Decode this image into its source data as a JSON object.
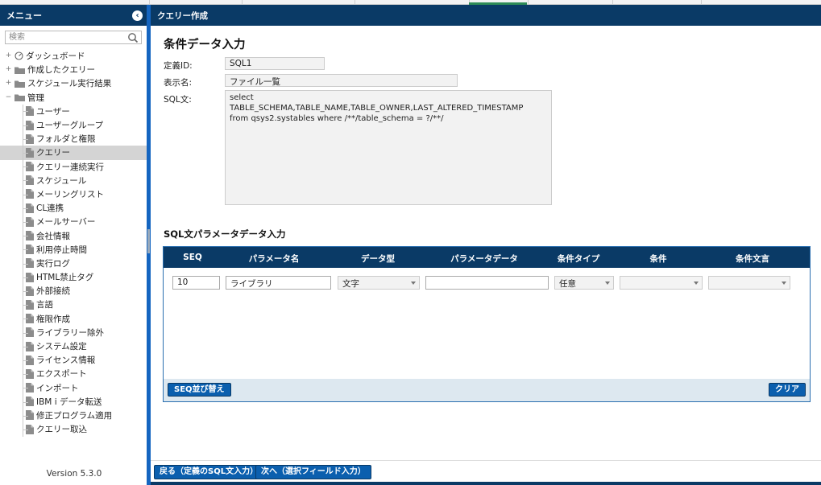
{
  "sidebar": {
    "title": "メニュー",
    "collapse_icon": "chevron-left-icon",
    "search_placeholder": "検索",
    "tree": [
      {
        "label": "ダッシュボード",
        "icon": "dashboard-icon",
        "level": 0,
        "expander": "+"
      },
      {
        "label": "作成したクエリー",
        "icon": "folder-icon",
        "level": 0,
        "expander": "+"
      },
      {
        "label": "スケジュール実行結果",
        "icon": "folder-icon",
        "level": 0,
        "expander": "+"
      },
      {
        "label": "管理",
        "icon": "folder-icon",
        "level": 0,
        "expander": "−"
      },
      {
        "label": "ユーザー",
        "icon": "document-icon",
        "level": 1
      },
      {
        "label": "ユーザーグループ",
        "icon": "document-icon",
        "level": 1
      },
      {
        "label": "フォルダと権限",
        "icon": "document-icon",
        "level": 1
      },
      {
        "label": "クエリー",
        "icon": "document-icon",
        "level": 1,
        "selected": true
      },
      {
        "label": "クエリー連続実行",
        "icon": "document-icon",
        "level": 1
      },
      {
        "label": "スケジュール",
        "icon": "document-icon",
        "level": 1
      },
      {
        "label": "メーリングリスト",
        "icon": "document-icon",
        "level": 1
      },
      {
        "label": "CL連携",
        "icon": "document-icon",
        "level": 1
      },
      {
        "label": "メールサーバー",
        "icon": "document-icon",
        "level": 1
      },
      {
        "label": "会社情報",
        "icon": "document-icon",
        "level": 1
      },
      {
        "label": "利用停止時間",
        "icon": "document-icon",
        "level": 1
      },
      {
        "label": "実行ログ",
        "icon": "document-icon",
        "level": 1
      },
      {
        "label": "HTML禁止タグ",
        "icon": "document-icon",
        "level": 1
      },
      {
        "label": "外部接続",
        "icon": "document-icon",
        "level": 1
      },
      {
        "label": "言語",
        "icon": "document-icon",
        "level": 1
      },
      {
        "label": "権限作成",
        "icon": "document-icon",
        "level": 1
      },
      {
        "label": "ライブラリー除外",
        "icon": "document-icon",
        "level": 1
      },
      {
        "label": "システム設定",
        "icon": "document-icon",
        "level": 1
      },
      {
        "label": "ライセンス情報",
        "icon": "document-icon",
        "level": 1
      },
      {
        "label": "エクスポート",
        "icon": "document-icon",
        "level": 1
      },
      {
        "label": "インポート",
        "icon": "document-icon",
        "level": 1
      },
      {
        "label": "IBM i データ転送",
        "icon": "document-icon",
        "level": 1
      },
      {
        "label": "修正プログラム適用",
        "icon": "document-icon",
        "level": 1
      },
      {
        "label": "クエリー取込",
        "icon": "document-icon",
        "level": 1
      }
    ],
    "version": "Version 5.3.0"
  },
  "main": {
    "header": "クエリー作成",
    "section_title": "条件データ入力",
    "fields": {
      "definition_id_label": "定義ID:",
      "definition_id_value": "SQL1",
      "display_name_label": "表示名:",
      "display_name_value": "ファイル一覧",
      "sql_label": "SQL文:",
      "sql_value": "select TABLE_SCHEMA,TABLE_NAME,TABLE_OWNER,LAST_ALTERED_TIMESTAMP\nfrom qsys2.systables where /**/table_schema = ?/**/"
    },
    "param_section_title": "SQL文パラメータデータ入力",
    "param_table": {
      "columns": [
        "SEQ",
        "パラメータ名",
        "データ型",
        "パラメータデータ",
        "条件タイプ",
        "条件",
        "条件文言"
      ],
      "row": {
        "seq": "10",
        "param_name": "ライブラリ",
        "data_type": "文字",
        "param_data": "",
        "condition_type": "任意",
        "condition": "",
        "condition_text": ""
      },
      "seq_sort_button": "SEQ並び替え",
      "clear_button": "クリア"
    },
    "footer": {
      "back_button": "戻る（定義のSQL文入力）",
      "next_button": "次へ（選択フィールド入力）"
    }
  },
  "colors": {
    "header_bg": "#0a3a66",
    "button_bg": "#0b5fae",
    "splitter": "#1565c0",
    "selected_row": "#d4d4d4"
  }
}
